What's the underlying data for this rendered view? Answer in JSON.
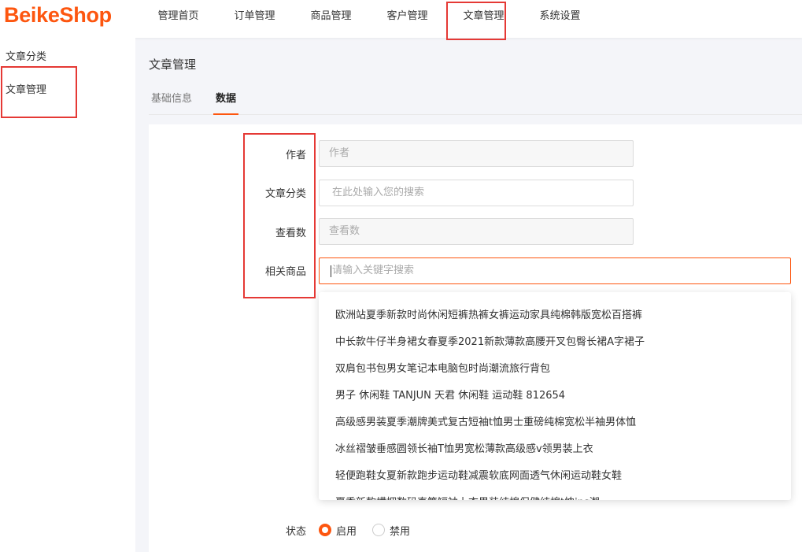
{
  "brand": {
    "logo": "BeikeShop",
    "accent": "#fd560f",
    "highlight": "#e53935"
  },
  "nav": [
    "管理首页",
    "订单管理",
    "商品管理",
    "客户管理",
    "文章管理",
    "系统设置"
  ],
  "sidebar": [
    "文章分类",
    "文章管理"
  ],
  "page_title": "文章管理",
  "tabs": [
    "基础信息",
    "数据"
  ],
  "active_tab": "数据",
  "form": {
    "author": {
      "label": "作者",
      "placeholder": "作者"
    },
    "category": {
      "label": "文章分类",
      "placeholder": "在此处输入您的搜索"
    },
    "views": {
      "label": "查看数",
      "placeholder": "查看数"
    },
    "products": {
      "label": "相关商品",
      "placeholder": "请输入关键字搜索"
    },
    "status": {
      "label": "状态",
      "options": [
        "启用",
        "禁用"
      ],
      "selected": "启用"
    }
  },
  "suggestions": [
    "欧洲站夏季新款时尚休闲短裤热裤女裤运动家具纯棉韩版宽松百搭裤",
    "中长款牛仔半身裙女春夏季2021新款薄款高腰开叉包臀长裙A字裙子",
    "双肩包书包男女笔记本电脑包时尚潮流旅行背包",
    "男子 休闲鞋 TANJUN 天君 休闲鞋 运动鞋 812654",
    "高级感男装夏季潮牌美式复古短袖t恤男士重磅纯棉宽松半袖男体恤",
    "冰丝褶皱垂感圆领长袖T恤男宽松薄款高级感v领男装上衣",
    "轻便跑鞋女夏新款跑步运动鞋减震软底网面透气休闲运动鞋女鞋",
    "夏季新款横拥数码直筒短袖上衣男装纯棉保健纯棉t恤ins潮"
  ]
}
